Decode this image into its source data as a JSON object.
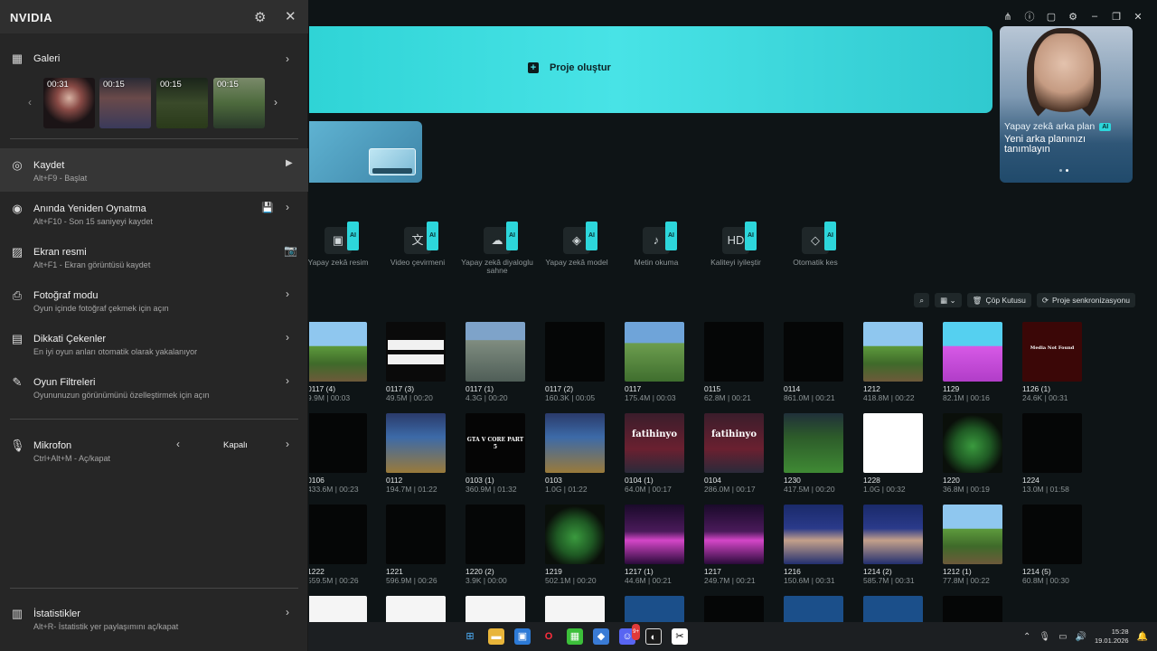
{
  "panel": {
    "brand": "NVIDIA",
    "gallery": {
      "title": "Galeri",
      "clips": [
        {
          "duration": "00:31"
        },
        {
          "duration": "00:15"
        },
        {
          "duration": "00:15"
        },
        {
          "duration": "00:15"
        }
      ]
    },
    "items": [
      {
        "title": "Kaydet",
        "sub": "Alt+F9 - Başlat"
      },
      {
        "title": "Anında Yeniden Oynatma",
        "sub": "Alt+F10 - Son 15 saniyeyi kaydet"
      },
      {
        "title": "Ekran resmi",
        "sub": "Alt+F1 - Ekran görüntüsü kaydet"
      },
      {
        "title": "Fotoğraf modu",
        "sub": "Oyun içinde fotoğraf çekmek için açın"
      },
      {
        "title": "Dikkati Çekenler",
        "sub": "En iyi oyun anları otomatik olarak yakalanıyor"
      },
      {
        "title": "Oyun Filtreleri",
        "sub": "Oyununuzun görünümünü özelleştirmek için açın"
      }
    ],
    "mic": {
      "title": "Mikrofon",
      "sub": "Ctrl+Alt+M - Aç/kapat",
      "value": "Kapalı"
    },
    "stats": {
      "title": "İstatistikler",
      "sub": "Alt+R- İstatistik yer paylaşımını aç/kapat"
    }
  },
  "editor": {
    "create_project": "Proje oluştur",
    "promo": {
      "title": "Yapay zekâ arka plan",
      "badge": "AI",
      "desc": "Yeni arka planınızı tanımlayın"
    },
    "tools": [
      {
        "label": "Yapay zekâ resim",
        "badge": "AI"
      },
      {
        "label": "Video çevirmeni",
        "badge": "AI"
      },
      {
        "label": "Yapay zekâ diyaloglu sahne",
        "badge": "AI"
      },
      {
        "label": "Yapay zekâ model",
        "badge": "AI"
      },
      {
        "label": "Metin okuma",
        "badge": "AI"
      },
      {
        "label": "Kaliteyi iyileştir",
        "badge": "AI"
      },
      {
        "label": "Otomatik kes",
        "badge": "AI"
      }
    ],
    "trash": "Çöp Kutusu",
    "sync": "Proje senkronizasyonu",
    "clips": [
      {
        "name": "0117 (4)",
        "meta": "9.9M | 00:03",
        "style": "t-mc"
      },
      {
        "name": "0117 (3)",
        "meta": "49.5M | 00:20",
        "style": "t-score"
      },
      {
        "name": "0117 (1)",
        "meta": "4.3G | 00:20",
        "style": "t-road"
      },
      {
        "name": "0117 (2)",
        "meta": "160.3K | 00:05",
        "style": "t-dark"
      },
      {
        "name": "0117",
        "meta": "175.4M | 00:03",
        "style": "t-mc2"
      },
      {
        "name": "0115",
        "meta": "62.8M | 00:21",
        "style": "t-dark"
      },
      {
        "name": "0114",
        "meta": "861.0M | 00:21",
        "style": "t-dark"
      },
      {
        "name": "1212",
        "meta": "418.8M | 00:22",
        "style": "t-mc"
      },
      {
        "name": "1129",
        "meta": "82.1M | 00:16",
        "style": "t-pink"
      },
      {
        "name": "1126 (1)",
        "meta": "24.6K | 00:31",
        "style": "t-red",
        "overlay": "Media Not Found"
      },
      {
        "name": "0106",
        "meta": "433.6M | 00:23",
        "style": "t-dark"
      },
      {
        "name": "0112",
        "meta": "194.7M | 01:22",
        "style": "t-rl"
      },
      {
        "name": "0103 (1)",
        "meta": "360.9M | 01:32",
        "style": "t-gtav",
        "overlay": "GTA V CORE PART 5"
      },
      {
        "name": "0103",
        "meta": "1.0G | 01:22",
        "style": "t-rl"
      },
      {
        "name": "0104 (1)",
        "meta": "64.0M | 00:17",
        "style": "t-ball",
        "overlay": "fatihinyo"
      },
      {
        "name": "0104",
        "meta": "286.0M | 00:17",
        "style": "t-ball",
        "overlay": "fatihinyo"
      },
      {
        "name": "1230",
        "meta": "417.5M | 00:20",
        "style": "t-pitch"
      },
      {
        "name": "1228",
        "meta": "1.0G | 00:32",
        "style": "t-white"
      },
      {
        "name": "1220",
        "meta": "36.8M | 00:19",
        "style": "t-frog"
      },
      {
        "name": "1224",
        "meta": "13.0M | 01:58",
        "style": "t-dark"
      },
      {
        "name": "1222",
        "meta": "559.5M | 00:26",
        "style": "t-dark"
      },
      {
        "name": "1221",
        "meta": "596.9M | 00:26",
        "style": "t-dark"
      },
      {
        "name": "1220 (2)",
        "meta": "3.9K | 00:00",
        "style": "t-dark"
      },
      {
        "name": "1219",
        "meta": "502.1M | 00:20",
        "style": "t-frog"
      },
      {
        "name": "1217 (1)",
        "meta": "44.6M | 00:21",
        "style": "t-synth"
      },
      {
        "name": "1217",
        "meta": "249.7M | 00:21",
        "style": "t-synth"
      },
      {
        "name": "1216",
        "meta": "150.6M | 00:31",
        "style": "t-soccer"
      },
      {
        "name": "1214 (2)",
        "meta": "585.7M | 00:31",
        "style": "t-soccer"
      },
      {
        "name": "1212 (1)",
        "meta": "77.8M | 00:22",
        "style": "t-mc"
      },
      {
        "name": "1214 (5)",
        "meta": "60.8M | 00:30",
        "style": "t-dark"
      },
      {
        "name": "",
        "meta": "",
        "style": "t-white2"
      },
      {
        "name": "",
        "meta": "",
        "style": "t-white2"
      },
      {
        "name": "",
        "meta": "",
        "style": "t-white2"
      },
      {
        "name": "",
        "meta": "",
        "style": "t-white2"
      },
      {
        "name": "",
        "meta": "",
        "style": "t-blue"
      },
      {
        "name": "",
        "meta": "",
        "style": "t-dark"
      },
      {
        "name": "",
        "meta": "",
        "style": "t-blue"
      },
      {
        "name": "",
        "meta": "",
        "style": "t-blue"
      },
      {
        "name": "",
        "meta": "",
        "style": "t-dark"
      }
    ]
  },
  "taskbar": {
    "time": "15:28",
    "date": "19.01.2026",
    "discord_badge": "9+"
  },
  "colors": {
    "accent": "#2fd4d6",
    "panel_bg": "#262626"
  }
}
